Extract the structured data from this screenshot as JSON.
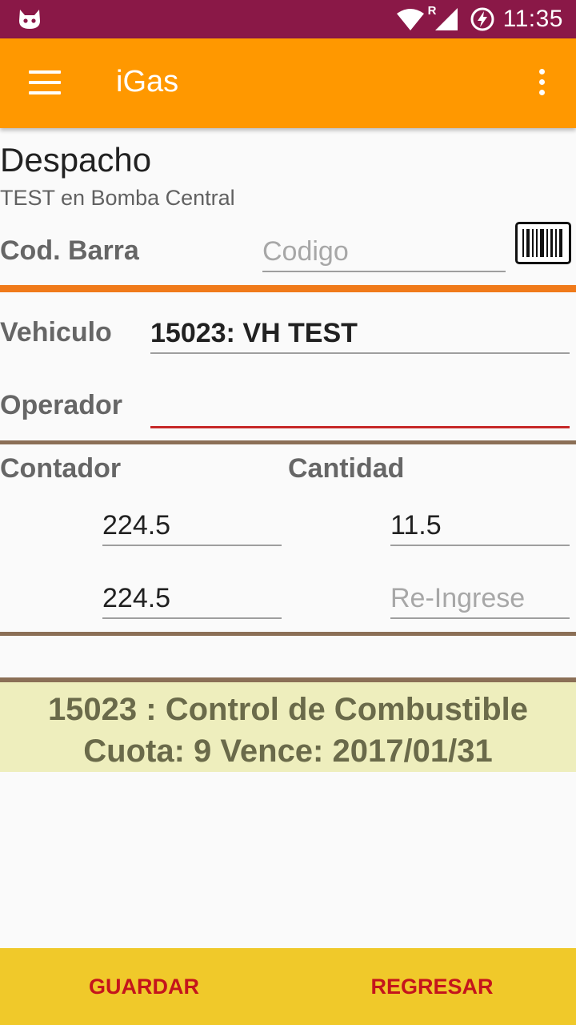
{
  "status_bar": {
    "time": "11:35",
    "network_indicator": "R",
    "icons": [
      "cat-icon",
      "wifi-icon",
      "signal-icon",
      "battery-charging-icon"
    ]
  },
  "app_bar": {
    "title": "iGas",
    "icons": [
      "menu-icon",
      "more-vert-icon"
    ]
  },
  "header": {
    "title": "Despacho",
    "subtitle": "TEST en Bomba Central"
  },
  "barcode": {
    "label": "Cod. Barra",
    "placeholder": "Codigo",
    "icon": "barcode-icon"
  },
  "vehicle": {
    "label": "Vehiculo",
    "value": "15023: VH TEST"
  },
  "operator": {
    "label": "Operador",
    "value": ""
  },
  "counters": {
    "contador_label": "Contador",
    "cantidad_label": "Cantidad",
    "contador_1": "224.5",
    "contador_2": "224.5",
    "cantidad_1": "11.5",
    "cantidad_2_placeholder": "Re-Ingrese"
  },
  "info": {
    "line1": "15023 : Control de Combustible",
    "line2": "Cuota: 9 Vence: 2017/01/31"
  },
  "actions": {
    "save": "GUARDAR",
    "back": "REGRESAR"
  },
  "colors": {
    "status_bar": "#8a1847",
    "app_bar": "#ff9800",
    "divider_orange": "#f07a1a",
    "divider_brown": "#8b6f56",
    "error_underline": "#c62828",
    "info_band": "#eeeebd",
    "bottom_bar": "#f0c92a",
    "action_text": "#c4151c"
  }
}
